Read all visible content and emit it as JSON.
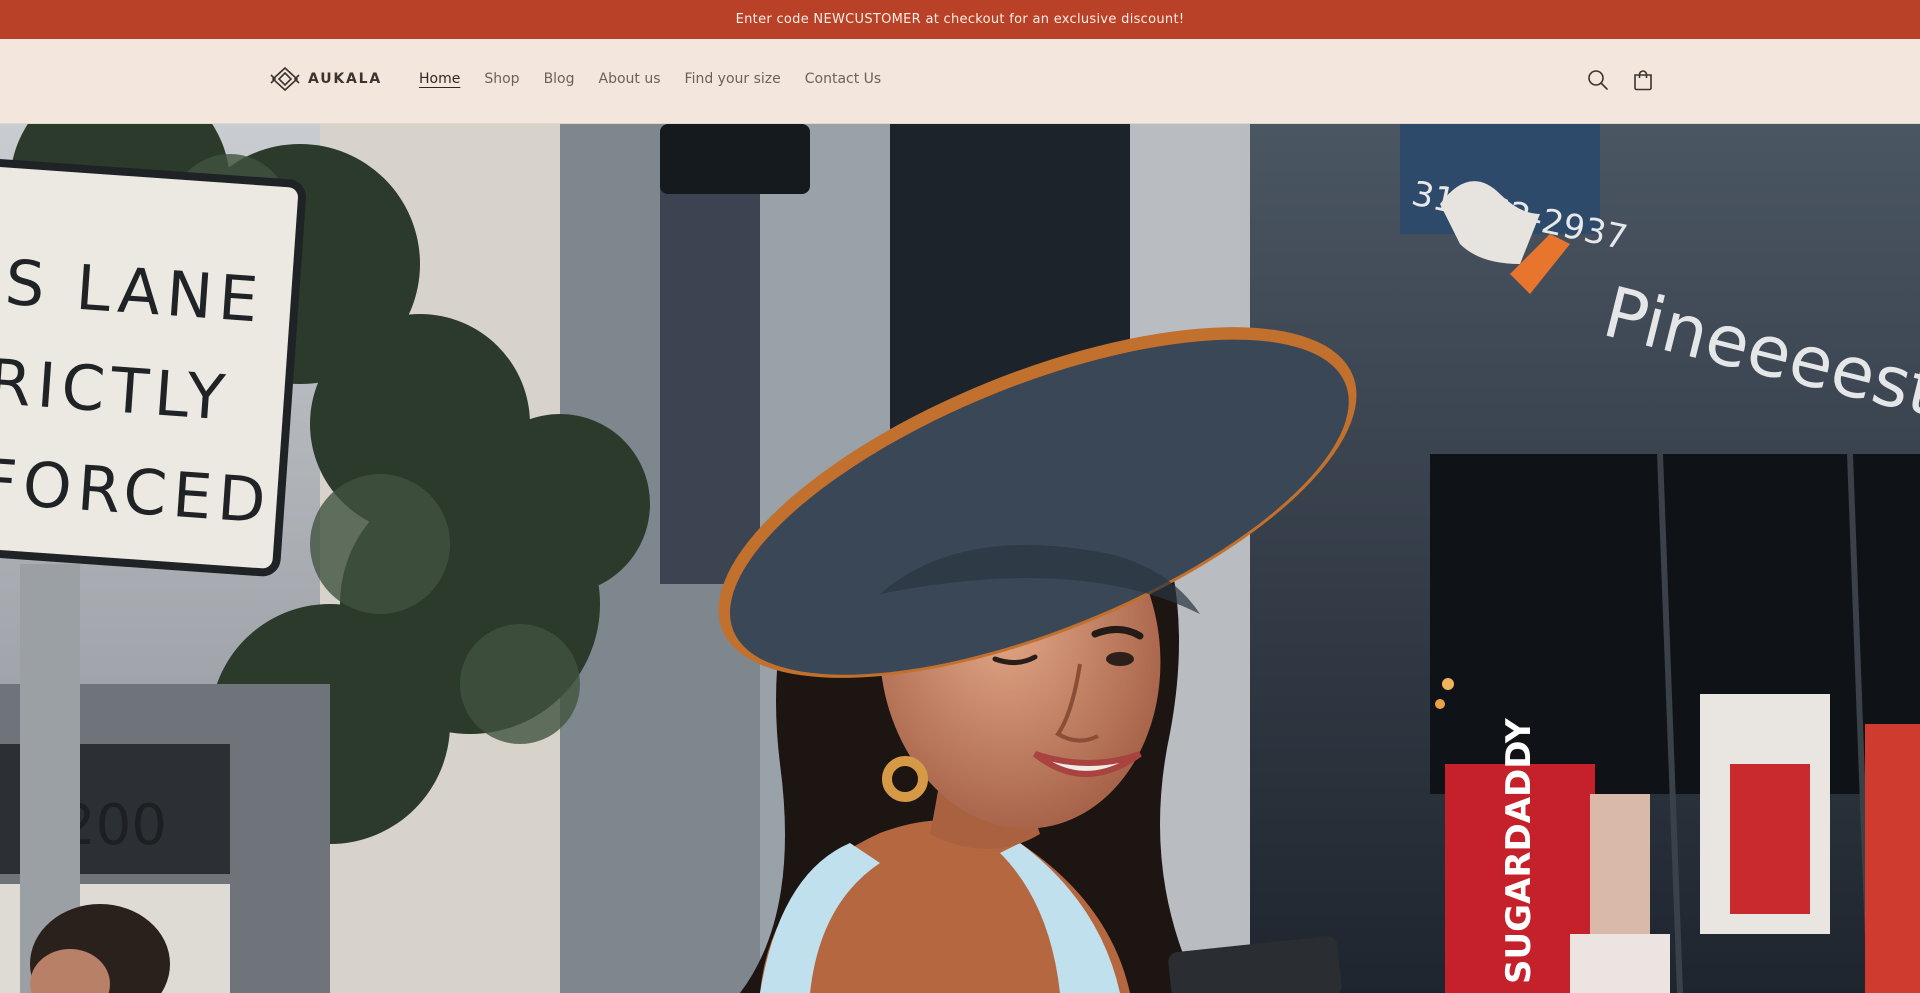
{
  "announcement": {
    "text": "Enter code NEWCUSTOMER at checkout for an exclusive discount!"
  },
  "header": {
    "logo_text": "AUKALA",
    "nav": [
      {
        "label": "Home",
        "active": true
      },
      {
        "label": "Shop",
        "active": false
      },
      {
        "label": "Blog",
        "active": false
      },
      {
        "label": "About us",
        "active": false
      },
      {
        "label": "Find your size",
        "active": false
      },
      {
        "label": "Contact Us",
        "active": false
      }
    ],
    "icons": {
      "search": "search-icon",
      "cart": "cart-icon"
    }
  },
  "hero": {
    "sign_text": [
      "S LANE",
      "RICTLY",
      "FORCED"
    ],
    "sign_number": "200",
    "storefront_text": "Pineeeest B",
    "phone_text": "31-462-2937",
    "banner_text": "SUGARDADDY",
    "colors": {
      "accent": "#b94127",
      "header_bg": "#f3e6dc"
    }
  }
}
